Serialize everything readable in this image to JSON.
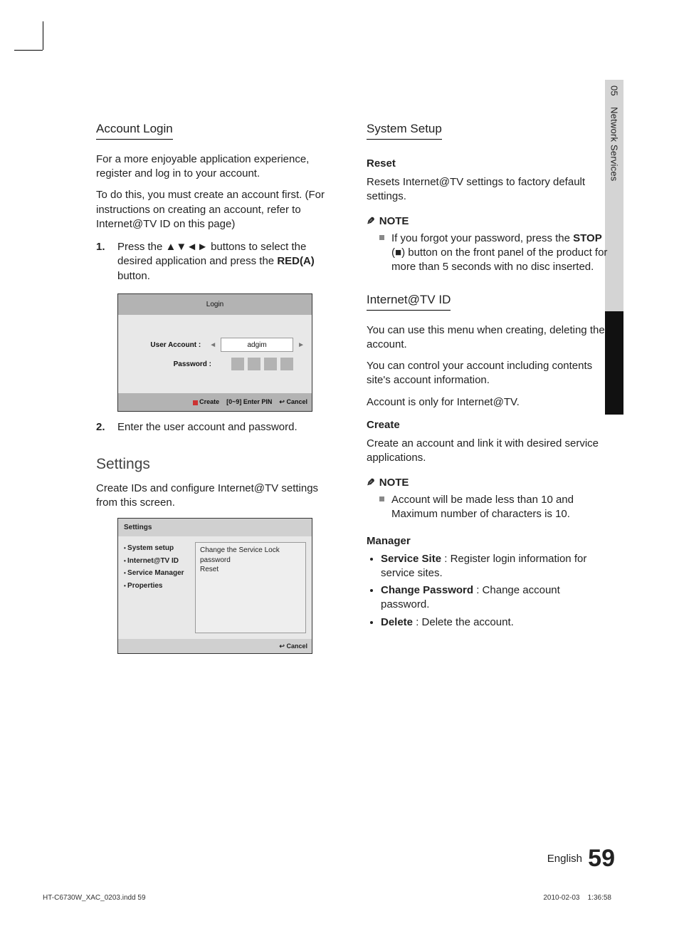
{
  "side": {
    "chapter": "05",
    "section": "Network Services"
  },
  "left": {
    "h_account": "Account Login",
    "p1": "For a more enjoyable application experience, register and log in to your account.",
    "p2": "To do this, you must create an account first. (For instructions on creating an account, refer to Internet@TV ID on this page)",
    "step1_a": "Press the ",
    "step1_arrows": "▲▼◄►",
    "step1_b": " buttons to select the desired application and press the ",
    "step1_red": "RED(A)",
    "step1_c": " button.",
    "login_panel": {
      "title": "Login",
      "ua_label": "User Account :",
      "ua_value": "adgim",
      "pw_label": "Password :",
      "ftr_create": "Create",
      "ftr_enter": "[0~9] Enter PIN",
      "ftr_cancel": "Cancel"
    },
    "step2": "Enter the user account and password.",
    "h_settings": "Settings",
    "p_settings": "Create IDs and configure Internet@TV settings from this screen.",
    "settings_panel": {
      "title": "Settings",
      "menu": [
        "System setup",
        "Internet@TV ID",
        "Service Manager",
        "Properties"
      ],
      "sub1": "Change the Service Lock password",
      "sub2": "Reset",
      "ftr": "Cancel"
    }
  },
  "right": {
    "h_sys": "System Setup",
    "reset_h": "Reset",
    "reset_p": "Resets Internet@TV settings to factory default settings.",
    "note_label": "NOTE",
    "note1_a": "If you forgot your password, press the ",
    "note1_stop": "STOP",
    "note1_b": " (",
    "note1_sq": "■",
    "note1_c": ") button on the front panel of the product for more than 5 seconds with no disc inserted.",
    "h_id": "Internet@TV ID",
    "id_p1": "You can use this menu when creating, deleting the account.",
    "id_p2": "You can control your account including contents site's account information.",
    "id_p3": "Account is only for Internet@TV.",
    "create_h": "Create",
    "create_p": "Create an account and link it with desired service applications.",
    "note2": "Account will be made less than 10 and Maximum number of characters is 10.",
    "mgr_h": "Manager",
    "mgr_site_b": "Service Site",
    "mgr_site": " : Register login information for service sites.",
    "mgr_cp_b": "Change Password",
    "mgr_cp": " : Change account password.",
    "mgr_del_b": "Delete",
    "mgr_del": " : Delete the account."
  },
  "footer": {
    "lang": "English",
    "page": "59"
  },
  "meta": {
    "file": "HT-C6730W_XAC_0203.indd   59",
    "date": "2010-02-03",
    "time": "1:36:58"
  }
}
